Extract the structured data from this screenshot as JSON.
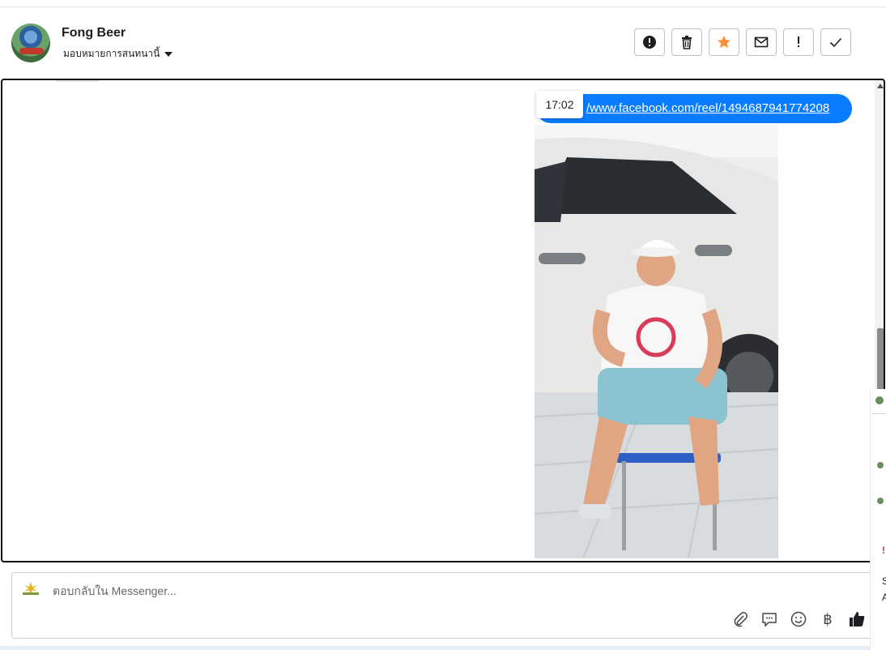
{
  "header": {
    "contact_name": "Fong Beer",
    "assign_label": "มอบหมายการสนทนานี้",
    "actions": [
      {
        "icon": "exclamation-circle-icon",
        "label": "Mark as spam"
      },
      {
        "icon": "trash-icon",
        "label": "Delete"
      },
      {
        "icon": "star-icon",
        "label": "Star",
        "color": "#f7923a"
      },
      {
        "icon": "envelope-icon",
        "label": "Mark as unread"
      },
      {
        "icon": "exclamation-icon",
        "label": "Follow up"
      },
      {
        "icon": "check-icon",
        "label": "Mark as done"
      }
    ]
  },
  "thread": {
    "messages": [
      {
        "type": "link",
        "visible_text": "/www.facebook.com/reel/1494687941774208",
        "timestamp": "17:02",
        "bubble_color": "#0a7cff"
      }
    ],
    "attachment": {
      "type": "video-thumbnail",
      "icon": "reel-preview-image"
    }
  },
  "composer": {
    "placeholder": "ตอบกลับใน Messenger...",
    "page_icon": "page-logo-icon",
    "tools": [
      {
        "icon": "paperclip-icon",
        "name": "attach"
      },
      {
        "icon": "speech-bubble-icon",
        "name": "saved-replies"
      },
      {
        "icon": "smiley-icon",
        "name": "emoji"
      },
      {
        "icon": "baht-icon",
        "name": "payment",
        "glyph": "฿"
      },
      {
        "icon": "thumbs-up-icon",
        "name": "like"
      }
    ]
  },
  "right_edge": {
    "partial_text": [
      "S",
      "A"
    ],
    "marker": "!"
  }
}
